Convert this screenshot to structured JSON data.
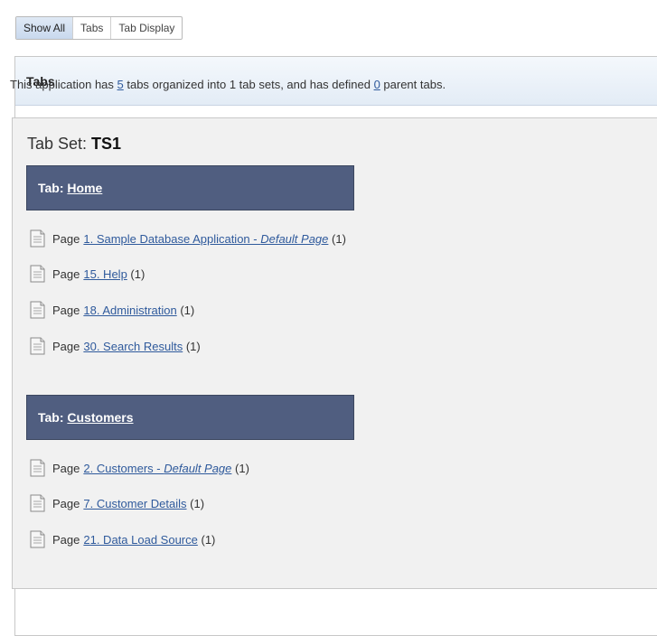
{
  "toolbar": {
    "tabs": [
      {
        "label": "Show All"
      },
      {
        "label": "Tabs"
      },
      {
        "label": "Tab Display"
      }
    ]
  },
  "region": {
    "title": "Tabs",
    "summary": {
      "prefix": "This application has ",
      "tab_count": "5",
      "middle": " tabs organized into 1 tab sets, and has defined ",
      "parent_count": "0",
      "suffix": " parent tabs."
    }
  },
  "tabset": {
    "label": "Tab Set: ",
    "name": "TS1",
    "tabs": [
      {
        "prefix": "Tab: ",
        "name": "Home",
        "pages": [
          {
            "word": "Page",
            "link": "1. Sample Database Application - ",
            "default": "Default Page",
            "count": "(1)"
          },
          {
            "word": "Page",
            "link": "15. Help ",
            "default": "",
            "count": "(1)"
          },
          {
            "word": "Page",
            "link": "18. Administration ",
            "default": "",
            "count": "(1)"
          },
          {
            "word": "Page",
            "link": "30. Search Results ",
            "default": "",
            "count": "(1)"
          }
        ]
      },
      {
        "prefix": "Tab: ",
        "name": "Customers",
        "pages": [
          {
            "word": "Page",
            "link": "2. Customers - ",
            "default": "Default Page",
            "count": "(1)"
          },
          {
            "word": "Page",
            "link": "7. Customer Details ",
            "default": "",
            "count": "(1)"
          },
          {
            "word": "Page",
            "link": "21. Data Load Source ",
            "default": "",
            "count": "(1)"
          }
        ]
      }
    ]
  },
  "colors": {
    "tab_header_bg": "#505e80",
    "link": "#2f5a9c",
    "region_header": "#e3ecf6"
  }
}
